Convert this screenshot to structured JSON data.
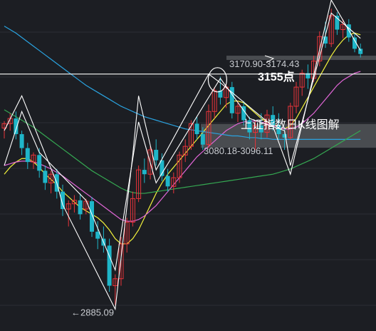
{
  "chart_data": {
    "type": "candlestick",
    "title": "上证指数日K线图解",
    "ylim": [
      2860,
      3240
    ],
    "grid": true,
    "colors": {
      "background": "#1c1e23",
      "up": "#e8343a",
      "down": "#1fb6c9",
      "ma_fast": "#f2f23c",
      "ma_mid": "#e066d6",
      "ma_slow": "#2aa3e0",
      "ma_long": "#35a852",
      "zone": "#6f7277",
      "level_line": "#ffffff",
      "trend_line": "#ffffff"
    },
    "key_level": {
      "value": 3155,
      "label": "3155点"
    },
    "zones": [
      {
        "low": 3170.9,
        "high": 3174.43,
        "label": "3170.90-3174.43"
      },
      {
        "low": 3080.18,
        "high": 3096.11,
        "label": "3080.18-3096.11"
      }
    ],
    "low_marker": {
      "value": 2885.09,
      "label": "←2885.09"
    },
    "candles": [
      [
        3093,
        3101,
        3081,
        3098
      ],
      [
        3098,
        3110,
        3090,
        3104
      ],
      [
        3104,
        3112,
        3080,
        3086
      ],
      [
        3086,
        3090,
        3062,
        3070
      ],
      [
        3070,
        3076,
        3046,
        3054
      ],
      [
        3054,
        3065,
        3046,
        3062
      ],
      [
        3062,
        3070,
        3036,
        3044
      ],
      [
        3044,
        3050,
        3022,
        3030
      ],
      [
        3030,
        3044,
        3018,
        3040
      ],
      [
        3040,
        3046,
        3012,
        3020
      ],
      [
        3020,
        3028,
        2992,
        3000
      ],
      [
        3000,
        3010,
        2980,
        3006
      ],
      [
        3006,
        3016,
        2996,
        3010
      ],
      [
        3010,
        3018,
        2988,
        2994
      ],
      [
        3000,
        3012,
        2994,
        3009
      ],
      [
        3009,
        3014,
        2968,
        2974
      ],
      [
        2974,
        2986,
        2954,
        2966
      ],
      [
        2966,
        2980,
        2950,
        2958
      ],
      [
        2958,
        2966,
        2905,
        2912
      ],
      [
        2912,
        2925,
        2890,
        2920
      ],
      [
        2920,
        2968,
        2912,
        2960
      ],
      [
        2960,
        2990,
        2950,
        2985
      ],
      [
        2985,
        3020,
        2980,
        3012
      ],
      [
        3012,
        3050,
        3008,
        3045
      ],
      [
        3045,
        3058,
        3030,
        3040
      ],
      [
        3040,
        3072,
        3034,
        3068
      ],
      [
        3068,
        3080,
        3050,
        3056
      ],
      [
        3056,
        3064,
        3032,
        3038
      ],
      [
        3038,
        3046,
        3020,
        3026
      ],
      [
        3026,
        3042,
        3018,
        3036
      ],
      [
        3036,
        3066,
        3030,
        3062
      ],
      [
        3062,
        3080,
        3054,
        3072
      ],
      [
        3072,
        3102,
        3068,
        3098
      ],
      [
        3098,
        3106,
        3080,
        3086
      ],
      [
        3086,
        3094,
        3068,
        3074
      ],
      [
        3074,
        3120,
        3070,
        3112
      ],
      [
        3112,
        3140,
        3104,
        3136
      ],
      [
        3136,
        3152,
        3120,
        3128
      ],
      [
        3128,
        3144,
        3116,
        3140
      ],
      [
        3140,
        3146,
        3104,
        3110
      ],
      [
        3110,
        3124,
        3100,
        3118
      ],
      [
        3118,
        3124,
        3096,
        3102
      ],
      [
        3102,
        3106,
        3080,
        3088
      ],
      [
        3088,
        3102,
        3068,
        3096
      ],
      [
        3096,
        3110,
        3080,
        3088
      ],
      [
        3088,
        3114,
        3082,
        3108
      ],
      [
        3108,
        3118,
        3090,
        3096
      ],
      [
        3096,
        3110,
        3080,
        3086
      ],
      [
        3086,
        3092,
        3068,
        3082
      ],
      [
        3082,
        3122,
        3080,
        3118
      ],
      [
        3118,
        3146,
        3110,
        3140
      ],
      [
        3140,
        3160,
        3130,
        3156
      ],
      [
        3156,
        3166,
        3138,
        3150
      ],
      [
        3150,
        3176,
        3146,
        3170
      ],
      [
        3170,
        3204,
        3164,
        3198
      ],
      [
        3198,
        3215,
        3185,
        3190
      ],
      [
        3190,
        3230,
        3186,
        3222
      ],
      [
        3222,
        3226,
        3200,
        3206
      ],
      [
        3206,
        3218,
        3196,
        3212
      ],
      [
        3212,
        3218,
        3192,
        3197
      ],
      [
        3197,
        3202,
        3180,
        3184
      ],
      [
        3184,
        3190,
        3174,
        3178
      ]
    ],
    "ma_series": [
      {
        "key": "ma_fast",
        "values": [
          3040,
          3048,
          3054,
          3058,
          3058,
          3054,
          3048,
          3040,
          3034,
          3028,
          3020,
          3014,
          3008,
          3002,
          2998,
          2994,
          2990,
          2984,
          2976,
          2966,
          2960,
          2960,
          2966,
          2976,
          2990,
          3004,
          3018,
          3030,
          3040,
          3048,
          3056,
          3064,
          3072,
          3080,
          3088,
          3096,
          3104,
          3112,
          3120,
          3124,
          3124,
          3122,
          3116,
          3110,
          3104,
          3100,
          3098,
          3094,
          3092,
          3096,
          3104,
          3116,
          3128,
          3140,
          3152,
          3164,
          3176,
          3186,
          3194,
          3200,
          3202,
          3200
        ]
      },
      {
        "key": "ma_mid",
        "values": [
          3050,
          3052,
          3054,
          3055,
          3055,
          3054,
          3052,
          3049,
          3046,
          3042,
          3038,
          3033,
          3028,
          3023,
          3018,
          3013,
          3008,
          3003,
          2998,
          2993,
          2988,
          2986,
          2986,
          2988,
          2992,
          2998,
          3004,
          3012,
          3020,
          3028,
          3036,
          3044,
          3052,
          3060,
          3066,
          3072,
          3078,
          3084,
          3090,
          3094,
          3098,
          3100,
          3101,
          3101,
          3100,
          3098,
          3096,
          3094,
          3092,
          3092,
          3094,
          3098,
          3104,
          3110,
          3118,
          3126,
          3134,
          3142,
          3148,
          3152,
          3156,
          3158
        ]
      },
      {
        "key": "ma_slow",
        "values": [
          3210,
          3206,
          3202,
          3197,
          3192,
          3187,
          3182,
          3177,
          3172,
          3167,
          3162,
          3157,
          3152,
          3147,
          3142,
          3138,
          3134,
          3130,
          3126,
          3122,
          3118,
          3115,
          3112,
          3109,
          3106,
          3104,
          3102,
          3100,
          3098,
          3096,
          3094,
          3092,
          3091,
          3090,
          3089,
          3088,
          3087,
          3086,
          3085,
          3084,
          3084,
          3083,
          3082,
          3082,
          3081,
          3081,
          3080,
          3080,
          3080,
          3080,
          3080,
          3080,
          3080,
          3080,
          3080,
          3080,
          3080,
          3080,
          3080,
          3080,
          3080,
          3080
        ]
      },
      {
        "key": "ma_long",
        "values": [
          3114,
          3110,
          3106,
          3102,
          3098,
          3094,
          3089,
          3084,
          3079,
          3074,
          3069,
          3064,
          3059,
          3054,
          3049,
          3044,
          3040,
          3036,
          3032,
          3028,
          3024,
          3021,
          3019,
          3018,
          3018,
          3019,
          3020,
          3021,
          3022,
          3023,
          3024,
          3025,
          3026,
          3027,
          3028,
          3029,
          3030,
          3031,
          3032,
          3033,
          3034,
          3035,
          3036,
          3037,
          3038,
          3039,
          3040,
          3042,
          3044,
          3046,
          3049,
          3052,
          3055,
          3058,
          3062,
          3066,
          3070,
          3074,
          3078,
          3082,
          3086,
          3090
        ]
      }
    ],
    "trend_polylines": [
      [
        [
          0,
          3090
        ],
        [
          3,
          3130
        ],
        [
          9,
          3030
        ],
        [
          10,
          3005
        ],
        [
          19,
          2885.09
        ],
        [
          22,
          3062
        ],
        [
          23,
          3130
        ],
        [
          26,
          3045
        ],
        [
          35,
          3155
        ],
        [
          37,
          3145
        ],
        [
          46,
          3095
        ],
        [
          49,
          3040
        ],
        [
          56,
          3240
        ],
        [
          61,
          3182
        ]
      ],
      [
        [
          0,
          3050
        ],
        [
          3,
          3112
        ],
        [
          6,
          3065
        ],
        [
          14,
          3010
        ],
        [
          19,
          2930
        ],
        [
          23,
          3100
        ],
        [
          26,
          3030
        ],
        [
          37,
          3150
        ],
        [
          42,
          3104
        ],
        [
          48,
          3090
        ],
        [
          49,
          3050
        ],
        [
          56,
          3225
        ],
        [
          61,
          3196
        ]
      ]
    ],
    "peak_circle": {
      "index": 37,
      "value": 3155
    }
  }
}
